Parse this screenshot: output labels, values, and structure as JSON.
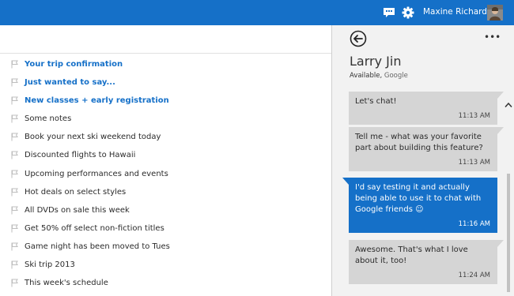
{
  "topbar": {
    "chat_icon": "chat-bubble-icon",
    "settings_icon": "gear-icon",
    "user_name": "Maxine Richardson",
    "accent": "#1570c8"
  },
  "messages": [
    {
      "subject": "Your trip confirmation",
      "unread": true
    },
    {
      "subject": "Just wanted to say...",
      "unread": true
    },
    {
      "subject": "New classes + early registration",
      "unread": true
    },
    {
      "subject": "Some notes",
      "unread": false
    },
    {
      "subject": "Book your next ski weekend today",
      "unread": false
    },
    {
      "subject": "Discounted flights to Hawaii",
      "unread": false
    },
    {
      "subject": "Upcoming performances and events",
      "unread": false
    },
    {
      "subject": "Hot deals on select styles",
      "unread": false
    },
    {
      "subject": "All DVDs on sale this week",
      "unread": false
    },
    {
      "subject": "Get 50% off select non-fiction titles",
      "unread": false
    },
    {
      "subject": "Game night has been moved to Tues",
      "unread": false
    },
    {
      "subject": "Ski trip 2013",
      "unread": false
    },
    {
      "subject": "This week's schedule",
      "unread": false
    }
  ],
  "chat": {
    "more_label": "•••",
    "contact_name": "Larry Jin",
    "status": "Available,",
    "service": "Google",
    "bubbles": [
      {
        "direction": "in",
        "text": "Let's chat!",
        "time": "11:13 AM"
      },
      {
        "direction": "in",
        "text": "Tell me - what was your favorite part about building this feature?",
        "time": "11:13 AM"
      },
      {
        "direction": "out",
        "text": "I'd say testing it and actually being able to use it to chat with Google friends",
        "emoji": "☺",
        "time": "11:16 AM"
      },
      {
        "direction": "in",
        "text": "Awesome. That's what I love about it, too!",
        "time": "11:24 AM"
      }
    ]
  }
}
